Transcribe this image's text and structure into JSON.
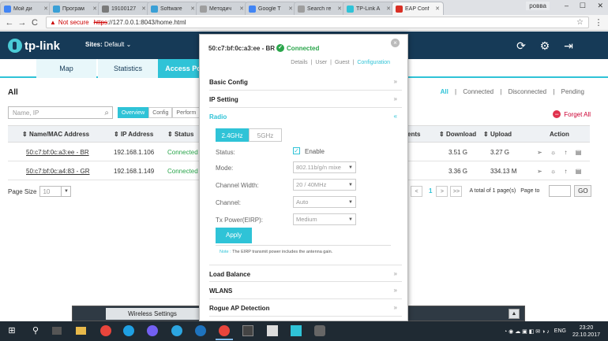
{
  "browser": {
    "tabs": [
      {
        "title": "Мой ди",
        "color": "#4285f4"
      },
      {
        "title": "Програм",
        "color": "#3aa0d6"
      },
      {
        "title": "19100127",
        "color": "#7a7a7a"
      },
      {
        "title": "Software",
        "color": "#3aa0d6"
      },
      {
        "title": "Методич",
        "color": "#9e9e9e"
      },
      {
        "title": "Google T",
        "color": "#4285f4"
      },
      {
        "title": "Search re",
        "color": "#9e9e9e"
      },
      {
        "title": "TP-Link A",
        "color": "#2fc3d7"
      },
      {
        "title": "EAP Conf",
        "color": "#d93025"
      }
    ],
    "active_tab": 8,
    "profile": "ровва",
    "minimize": "–",
    "maximize": "☐",
    "close": "✕",
    "back": "←",
    "forward": "→",
    "reload": "C",
    "warning_icon": "▲",
    "not_secure": "Not secure",
    "url_https": "https",
    "url_rest": "://127.0.0.1:8043/home.html",
    "star": "☆",
    "menu": "⋮"
  },
  "header": {
    "logo_text": "tp-link",
    "sites_label": "Sites:",
    "sites_value": "Default",
    "chevron": "⌄",
    "refresh_icon": "⟳",
    "settings_icon": "⚙",
    "logout_icon": "⇥"
  },
  "nav": {
    "tabs": [
      "Map",
      "Statistics",
      "Access Points"
    ],
    "active": 2
  },
  "content": {
    "title": "All",
    "filters": [
      "All",
      "Connected",
      "Disconnected",
      "Pending"
    ],
    "filter_sep": "|",
    "search_placeholder": "Name, IP",
    "search_icon": "⌕",
    "subtabs": [
      "Overview",
      "Config",
      "Perform"
    ],
    "forget_all": "Forget All",
    "minus": "−",
    "columns": {
      "name": "Name/MAC Address",
      "ip": "IP Address",
      "status": "Status",
      "clients": "ents",
      "download": "Download",
      "upload": "Upload",
      "action": "Action"
    },
    "sort_icon": "⇕",
    "rows": [
      {
        "mac": "50:c7:bf:0c:a3:ee - BR",
        "ip": "192.168.1.106",
        "status": "Connected",
        "download": "3.51 G",
        "upload": "3.27 G"
      },
      {
        "mac": "50:c7:bf:0c:a4:83 - GR",
        "ip": "192.168.1.149",
        "status": "Connected",
        "download": "3.36 G",
        "upload": "334.13 M"
      }
    ],
    "action_icons": "➢ ☼ ↑ ▤",
    "page_size_label": "Page Size",
    "page_size_value": "10",
    "prev": "<",
    "page": "1",
    "next": ">",
    "last": ">>",
    "total_text": "A total of 1 page(s)",
    "page_to": "Page to",
    "go": "GO"
  },
  "panel": {
    "mac": "50:c7:bf:0c:a3:ee - BR",
    "status": "Connected",
    "check": "✓",
    "close": "×",
    "tabs": [
      "Details",
      "User",
      "Guest",
      "Configuration"
    ],
    "tab_sep": "|",
    "sections_top": [
      "Basic Config",
      "IP Setting",
      "Radio"
    ],
    "sections_bottom": [
      "Load Balance",
      "WLANS",
      "Rogue AP Detection"
    ],
    "chev_down": "»",
    "chev_up": "«",
    "radio_tabs": [
      "2.4GHz",
      "5GHz"
    ],
    "status_label": "Status:",
    "enable_label": "Enable",
    "checkmark": "✓",
    "mode_label": "Mode:",
    "mode_value": "802.11b/g/n mixe",
    "width_label": "Channel Width:",
    "width_value": "20 / 40MHz",
    "channel_label": "Channel:",
    "channel_value": "Auto",
    "power_label": "Tx Power(EIRP):",
    "power_value": "Medium",
    "select_arrow": "▼",
    "apply": "Apply",
    "note_label": "Note :",
    "note_text": "The EIRP transmit power includes the antenna gain."
  },
  "wireless_bar": {
    "label": "Wireless Settings",
    "button": "▲"
  },
  "taskbar": {
    "start": "⊞",
    "search": "⚲",
    "lang": "ENG",
    "time": "23:20",
    "date": "22.10.2017"
  }
}
